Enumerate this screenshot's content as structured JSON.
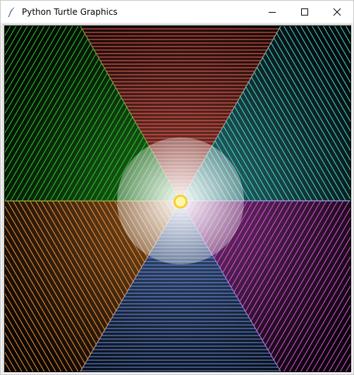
{
  "window": {
    "title": "Python Turtle Graphics",
    "controls": {
      "minimize_icon": "minimize-icon",
      "maximize_icon": "maximize-icon",
      "close_icon": "close-icon"
    }
  },
  "canvas": {
    "background": "#000000",
    "wedges": [
      {
        "name": "top-red",
        "color": "#ff6a5c",
        "direction": "up",
        "hatch": "horizontal"
      },
      {
        "name": "top-right-cyan",
        "color": "#4fe0e0",
        "direction": "upper-right",
        "hatch": "diagonal"
      },
      {
        "name": "bottom-right-magenta",
        "color": "#e65ae6",
        "direction": "lower-right",
        "hatch": "diagonal"
      },
      {
        "name": "bottom-blue",
        "color": "#6f9cf2",
        "direction": "down",
        "hatch": "horizontal"
      },
      {
        "name": "bottom-left-orange",
        "color": "#ff9a3c",
        "direction": "lower-left",
        "hatch": "diagonal"
      },
      {
        "name": "top-left-green",
        "color": "#32d232",
        "direction": "upper-left",
        "hatch": "diagonal"
      }
    ],
    "center_dot": {
      "fill": "#fff6a8",
      "ring": "#f5cf3a"
    }
  }
}
